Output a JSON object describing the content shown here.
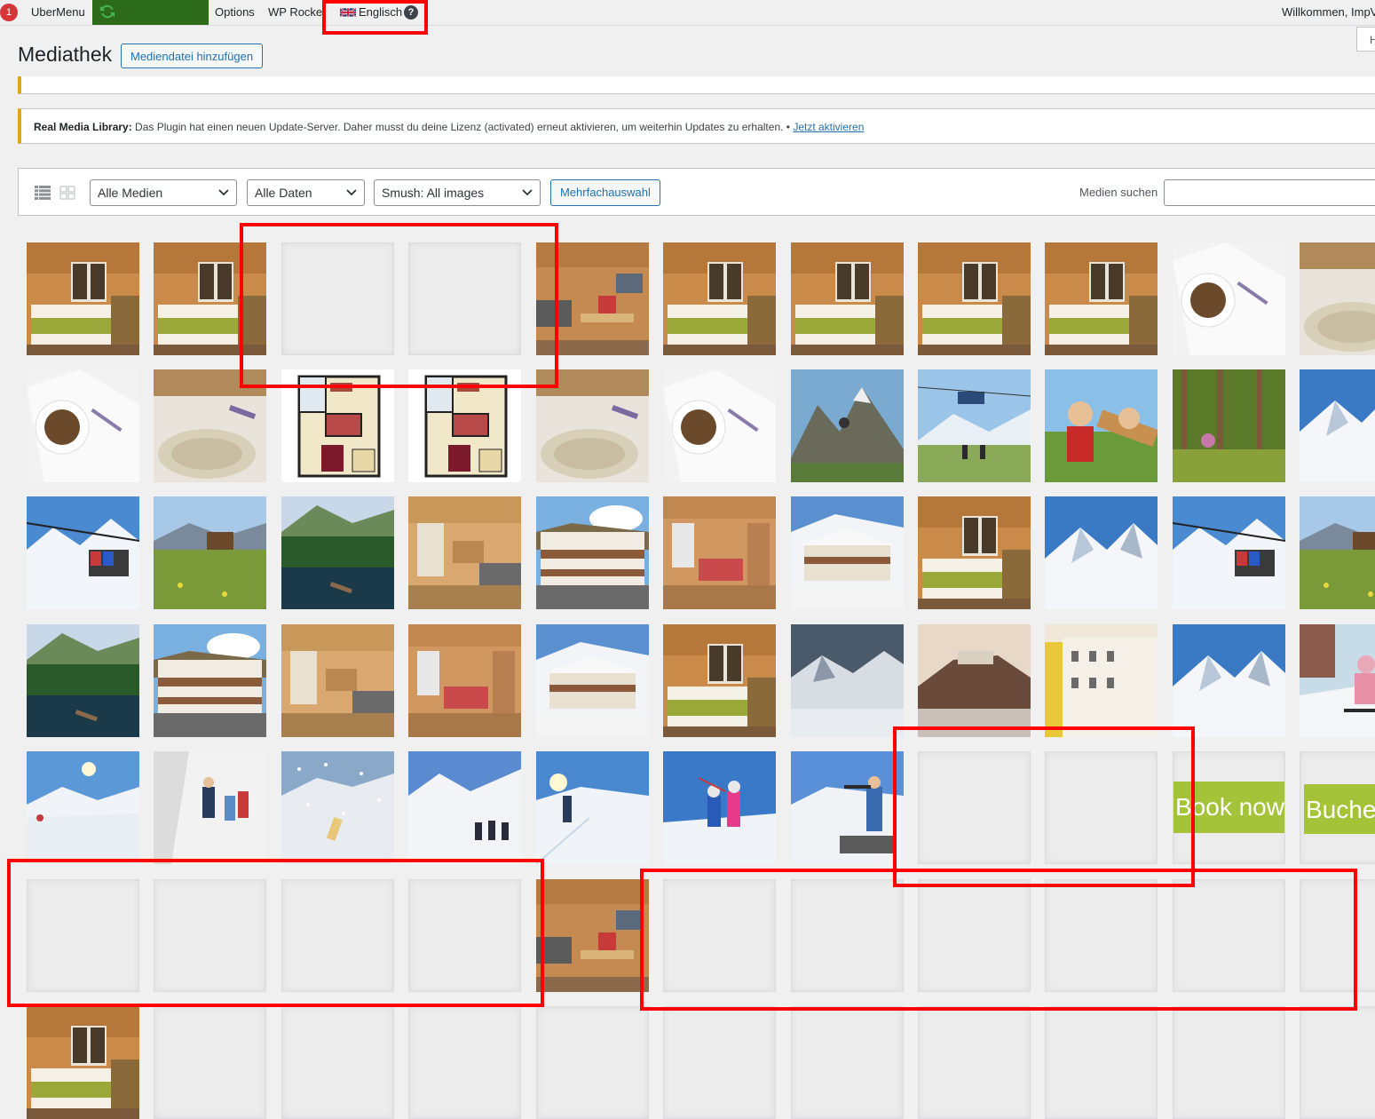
{
  "admin_bar": {
    "notification_count": "1",
    "items": [
      "UberMenu",
      "Options",
      "WP Rocket"
    ],
    "language": "Englisch",
    "help_symbol": "?",
    "welcome": "Willkommen, ImpV"
  },
  "screen_tab_label": "H",
  "header": {
    "title": "Mediathek",
    "add_button": "Mediendatei hinzufügen"
  },
  "notice": {
    "plugin_name": "Real Media Library:",
    "message": " Das Plugin hat einen neuen Update-Server. Daher musst du deine Lizenz (activated) erneut aktivieren, um weiterhin Updates zu erhalten. • ",
    "link": "Jetzt aktivieren"
  },
  "toolbar": {
    "filter_media": "Alle Medien",
    "filter_dates": "Alle Daten",
    "filter_smush": "Smush: All images",
    "bulk_select": "Mehrfachauswahl",
    "search_label": "Medien suchen",
    "search_value": ""
  },
  "book_banners": [
    "Book now",
    "Buche"
  ],
  "media_grid": [
    [
      "bedroom",
      "bedroom",
      "empty",
      "empty",
      "living-room",
      "bedroom",
      "bedroom",
      "bedroom",
      "bedroom",
      "coffee",
      "towel"
    ],
    [
      "coffee",
      "towel",
      "floorplan",
      "floorplan",
      "towel",
      "coffee",
      "mountain",
      "ski-lift",
      "kids",
      "forest",
      "snow-mountain"
    ],
    [
      "snow-lift",
      "meadow",
      "lake",
      "apartment",
      "chalet-summer",
      "living-red",
      "chalet-winter",
      "bedroom",
      "snow-mountain",
      "snow-lift",
      "meadow"
    ],
    [
      "lake",
      "chalet-summer",
      "apartment",
      "living-red",
      "chalet-winter",
      "bedroom",
      "snow-dusk",
      "castle-town",
      "town-house",
      "snow-mountain",
      "kid-skier"
    ],
    [
      "ski-slope",
      "hikers-snow",
      "snowfall",
      "skiers-group",
      "cross-country",
      "kids-ski",
      "biathlon",
      "empty",
      "empty",
      "book-now",
      "buche"
    ],
    [
      "empty",
      "empty",
      "empty",
      "empty",
      "living-room",
      "empty",
      "empty",
      "empty",
      "empty",
      "empty",
      "empty"
    ],
    [
      "bedroom",
      "empty",
      "empty",
      "empty",
      "empty",
      "empty",
      "empty",
      "empty",
      "empty",
      "empty",
      "empty"
    ]
  ]
}
